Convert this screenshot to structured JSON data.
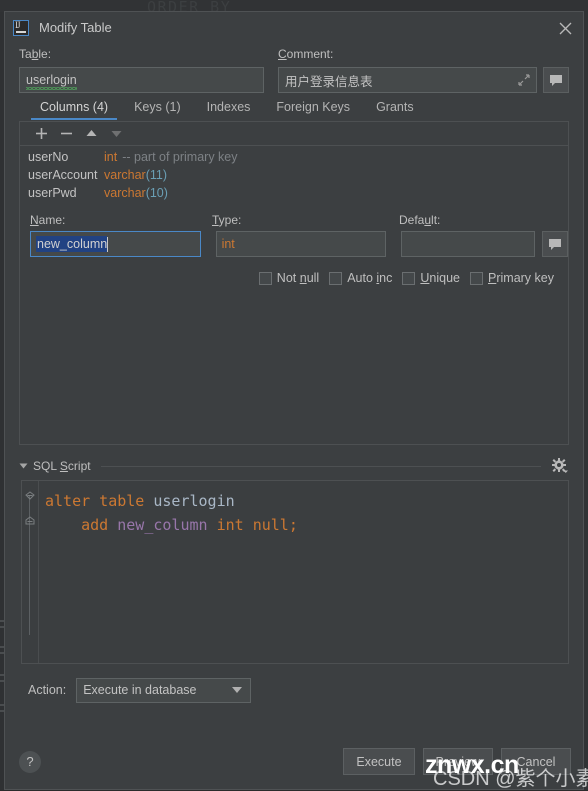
{
  "backdrop": {
    "editor_text": "ORDER BY"
  },
  "window": {
    "title": "Modify Table",
    "app_icon": "intellij-idea-icon",
    "close_icon": "close-icon"
  },
  "top_form": {
    "table_label": "Table:",
    "table_label_mn_before": "Ta",
    "table_label_mn": "b",
    "table_label_mn_after": "le:",
    "table_value": "userlogin",
    "comment_label": "Comment:",
    "comment_label_mn": "C",
    "comment_label_rest": "omment:",
    "comment_value": "用户登录信息表",
    "expand_icon": "expand-diagonal-icon",
    "comment_button_icon": "comment-bubble-icon"
  },
  "tabs": [
    {
      "label": "Columns (4)",
      "active": true
    },
    {
      "label": "Keys (1)",
      "active": false
    },
    {
      "label": "Indexes",
      "active": false
    },
    {
      "label": "Foreign Keys",
      "active": false
    },
    {
      "label": "Grants",
      "active": false
    }
  ],
  "panel_toolbar": [
    {
      "icon": "plus-icon",
      "name": "add-column-button",
      "enabled": true
    },
    {
      "icon": "minus-icon",
      "name": "remove-column-button",
      "enabled": true
    },
    {
      "icon": "arrow-up-icon",
      "name": "move-up-button",
      "enabled": true
    },
    {
      "icon": "arrow-down-icon",
      "name": "move-down-button",
      "enabled": false
    }
  ],
  "columns": [
    {
      "name": "userNo",
      "type": "int",
      "length": "",
      "note": "-- part of primary key"
    },
    {
      "name": "userAccount",
      "type": "varchar",
      "length": "(11)",
      "note": ""
    },
    {
      "name": "userPwd",
      "type": "varchar",
      "length": "(10)",
      "note": ""
    }
  ],
  "column_form": {
    "name_label": "Name:",
    "name_label_mn": "N",
    "name_label_rest": "ame:",
    "name_value": "new_column",
    "type_label": "Type:",
    "type_label_mn": "T",
    "type_label_rest": "ype:",
    "type_value": "int",
    "default_label": "Default:",
    "default_label_pre": "Defa",
    "default_label_mn": "u",
    "default_label_post": "lt:",
    "default_value": "",
    "default_button_icon": "comment-bubble-icon",
    "checkboxes": [
      {
        "label_pre": "Not ",
        "label_mn": "n",
        "label_post": "ull",
        "checked": false,
        "name": "not-null-checkbox"
      },
      {
        "label_pre": "Auto ",
        "label_mn": "i",
        "label_post": "nc",
        "checked": false,
        "name": "auto-inc-checkbox"
      },
      {
        "label_pre": "",
        "label_mn": "U",
        "label_post": "nique",
        "checked": false,
        "name": "unique-checkbox"
      },
      {
        "label_pre": "",
        "label_mn": "P",
        "label_post": "rimary key",
        "checked": false,
        "name": "primary-key-checkbox"
      }
    ]
  },
  "sql_section": {
    "title": "SQL Script",
    "title_pre": "SQL ",
    "title_mn": "S",
    "title_post": "cript",
    "collapse_icon": "triangle-down-icon",
    "settings_icon": "gear-icon",
    "line1_kw1": "alter table ",
    "line1_id": "userlogin",
    "line2_indent": "    ",
    "line2_kw": "add ",
    "line2_col": "new_column",
    "line2_rest": " int null;"
  },
  "bottom": {
    "action_label": "Action:",
    "action_value": "Execute in database",
    "help_label": "?",
    "buttons": [
      {
        "label": "Execute",
        "name": "execute-button"
      },
      {
        "label": "Preview",
        "name": "preview-button"
      },
      {
        "label": "Cancel",
        "name": "cancel-button"
      }
    ]
  },
  "watermark": {
    "main": "znwx.cn",
    "sub": "CSDN @紫个小素"
  },
  "colors": {
    "accent": "#4a88c7",
    "keyword": "#cc7832",
    "identifier": "#a9b7c6",
    "column": "#9876aa",
    "number": "#6a9fb5",
    "dialog_bg": "#3c3f41"
  }
}
